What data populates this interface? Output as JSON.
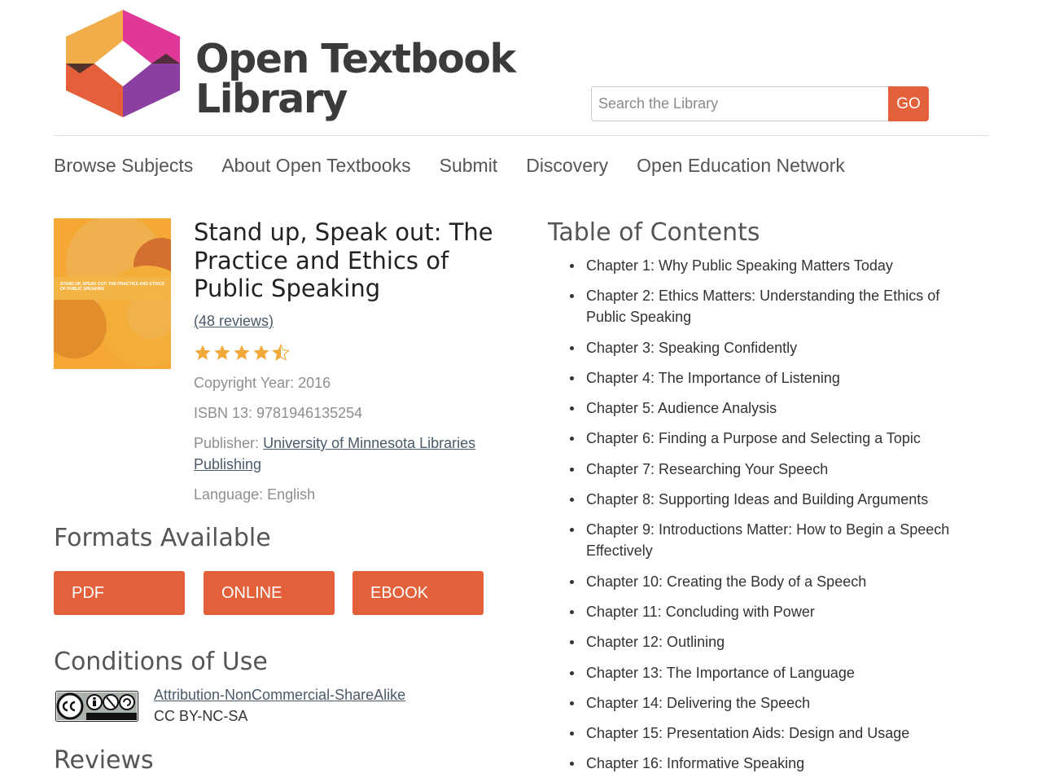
{
  "brand": {
    "line1": "Open Textbook",
    "line2": "Library"
  },
  "search": {
    "placeholder": "Search the Library",
    "button_label": "GO"
  },
  "nav": [
    "Browse Subjects",
    "About Open Textbooks",
    "Submit",
    "Discovery",
    "Open Education Network"
  ],
  "book": {
    "cover_text": "STAND UP, SPEAK OUT: THE PRACTICE AND ETHICS OF PUBLIC SPEAKING",
    "title": "Stand up, Speak out: The Practice and Ethics of Public Speaking",
    "reviews_link": "(48 reviews)",
    "rating": 4.5,
    "copyright": "Copyright Year: 2016",
    "isbn": "ISBN 13: 9781946135254",
    "publisher_label": "Publisher:",
    "publisher": "University of Minnesota Libraries Publishing",
    "language": "Language: English"
  },
  "formats": {
    "heading": "Formats Available",
    "items": [
      "PDF",
      "ONLINE",
      "EBOOK"
    ]
  },
  "conditions": {
    "heading": "Conditions of Use",
    "license_name": "Attribution-NonCommercial-ShareAlike",
    "license_code": "CC BY-NC-SA"
  },
  "reviews_heading": "Reviews",
  "toc": {
    "heading": "Table of Contents",
    "items": [
      "Chapter 1: Why Public Speaking Matters Today",
      "Chapter 2: Ethics Matters: Understanding the Ethics of Public Speaking",
      "Chapter 3: Speaking Confidently",
      "Chapter 4: The Importance of Listening",
      "Chapter 5: Audience Analysis",
      "Chapter 6: Finding a Purpose and Selecting a Topic",
      "Chapter 7: Researching Your Speech",
      "Chapter 8: Supporting Ideas and Building Arguments",
      "Chapter 9: Introductions Matter: How to Begin a Speech Effectively",
      "Chapter 10: Creating the Body of a Speech",
      "Chapter 11: Concluding with Power",
      "Chapter 12: Outlining",
      "Chapter 13: The Importance of Language",
      "Chapter 14: Delivering the Speech",
      "Chapter 15: Presentation Aids: Design and Usage",
      "Chapter 16: Informative Speaking"
    ]
  },
  "colors": {
    "accent": "#e2603a",
    "star": "#f2a93b"
  }
}
